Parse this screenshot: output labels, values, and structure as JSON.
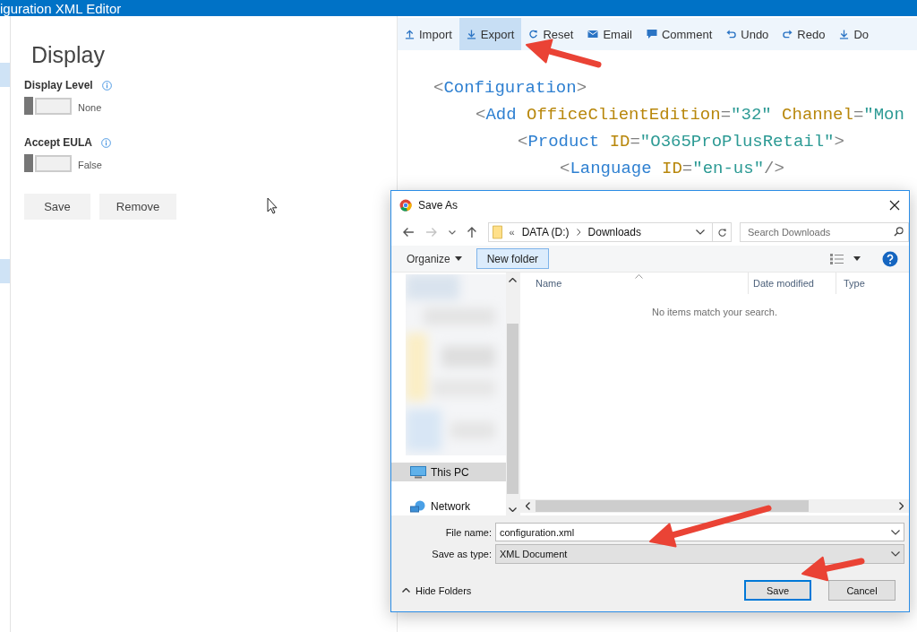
{
  "app": {
    "title": "iguration XML Editor"
  },
  "sidebar": {
    "items": [
      {
        "selected": true
      },
      {
        "selected": true
      }
    ]
  },
  "panel": {
    "heading": "Display",
    "settings": [
      {
        "label": "Display Level",
        "on": false,
        "value": "None"
      },
      {
        "label": "Accept EULA",
        "on": false,
        "value": "False"
      }
    ],
    "buttons": [
      "Save",
      "Remove"
    ]
  },
  "toolbar": [
    {
      "label": "Import",
      "kind": "upload",
      "selected": false
    },
    {
      "label": "Export",
      "kind": "download",
      "selected": true
    },
    {
      "label": "Reset",
      "kind": "refresh",
      "selected": false
    },
    {
      "label": "Email",
      "kind": "mail",
      "selected": false
    },
    {
      "label": "Comment",
      "kind": "comment",
      "selected": false
    },
    {
      "label": "Undo",
      "kind": "undo",
      "selected": false
    },
    {
      "label": "Redo",
      "kind": "redo",
      "selected": false
    },
    {
      "label": "Do",
      "kind": "download",
      "selected": false
    }
  ],
  "code": [
    {
      "tokens": [
        {
          "kind": "punct",
          "text": "<"
        },
        {
          "kind": "tag",
          "text": "Configuration"
        },
        {
          "kind": "punct",
          "text": ">"
        }
      ],
      "children": [
        {
          "tokens": [
            {
              "kind": "punct",
              "text": "<"
            },
            {
              "kind": "tag",
              "text": "Add"
            },
            {
              "kind": "attr",
              "text": " OfficeClientEdition"
            },
            {
              "kind": "punct",
              "text": "="
            },
            {
              "kind": "value",
              "text": "\"32\""
            },
            {
              "kind": "attr",
              "text": " Channel"
            },
            {
              "kind": "punct",
              "text": "="
            },
            {
              "kind": "value",
              "text": "\"Mon"
            }
          ],
          "children": [
            {
              "tokens": [
                {
                  "kind": "punct",
                  "text": "<"
                },
                {
                  "kind": "tag",
                  "text": "Product"
                },
                {
                  "kind": "attr",
                  "text": " ID"
                },
                {
                  "kind": "punct",
                  "text": "="
                },
                {
                  "kind": "value",
                  "text": "\"O365ProPlusRetail\""
                },
                {
                  "kind": "punct",
                  "text": ">"
                }
              ],
              "children": [
                {
                  "tokens": [
                    {
                      "kind": "punct",
                      "text": "<"
                    },
                    {
                      "kind": "tag",
                      "text": "Language"
                    },
                    {
                      "kind": "attr",
                      "text": " ID"
                    },
                    {
                      "kind": "punct",
                      "text": "="
                    },
                    {
                      "kind": "value",
                      "text": "\"en-us\""
                    },
                    {
                      "kind": "punct",
                      "text": "/>"
                    }
                  ]
                }
              ]
            }
          ]
        }
      ]
    }
  ],
  "dialog": {
    "title": "Save As",
    "path_overflow": "«",
    "path": [
      "DATA (D:)",
      "Downloads"
    ],
    "search": {
      "placeholder": "Search Downloads"
    },
    "organize": "Organize",
    "new_folder": "New folder",
    "nav": [
      {
        "label": "This PC",
        "kind": "computer",
        "selected": true
      },
      {
        "label": "Network",
        "kind": "network",
        "selected": false
      }
    ],
    "columns": [
      "Name",
      "Date modified",
      "Type"
    ],
    "empty_message": "No items match your search.",
    "file_name_label": "File name:",
    "file_name": "configuration.xml",
    "type_label": "Save as type:",
    "type": "XML Document",
    "hide_folders": "Hide Folders",
    "buttons": [
      {
        "label": "Save",
        "default": true
      },
      {
        "label": "Cancel",
        "default": false
      }
    ]
  }
}
